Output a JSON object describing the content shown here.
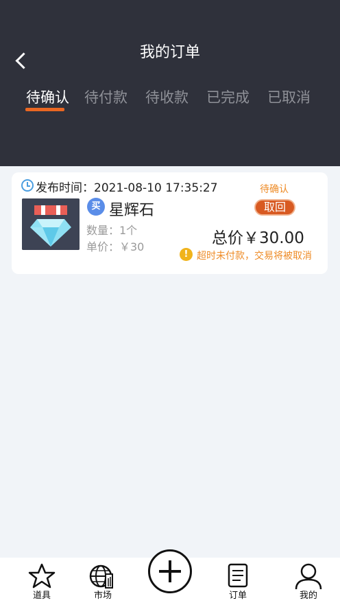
{
  "header": {
    "title": "我的订单",
    "back_icon": "chevron-left-icon"
  },
  "tabs": [
    {
      "label": "待确认",
      "active": true
    },
    {
      "label": "待付款",
      "active": false
    },
    {
      "label": "待收款",
      "active": false
    },
    {
      "label": "已完成",
      "active": false
    },
    {
      "label": "已取消",
      "active": false
    }
  ],
  "order": {
    "publish_time": "发布时间：2021-08-10  17:35:27",
    "status": "待确认",
    "cancel_label": "取回",
    "type_badge": "买",
    "item_name": "星辉石",
    "quantity": "数量：1个",
    "unit_price": "单价：￥30",
    "total": "总价￥30.00",
    "warning": "超时未付款，交易将被取消"
  },
  "bottom_nav": [
    {
      "label": "道具",
      "icon": "star-icon"
    },
    {
      "label": "市场",
      "icon": "market-globe-icon"
    },
    {
      "label": "",
      "icon": "plus-icon"
    },
    {
      "label": "订单",
      "icon": "document-icon"
    },
    {
      "label": "我的",
      "icon": "user-icon"
    }
  ],
  "colors": {
    "header_bg": "#2f313b",
    "accent": "#ea6722",
    "warning": "#ee8b26",
    "badge": "#5a8de8",
    "page_bg": "#f1f4f8"
  }
}
